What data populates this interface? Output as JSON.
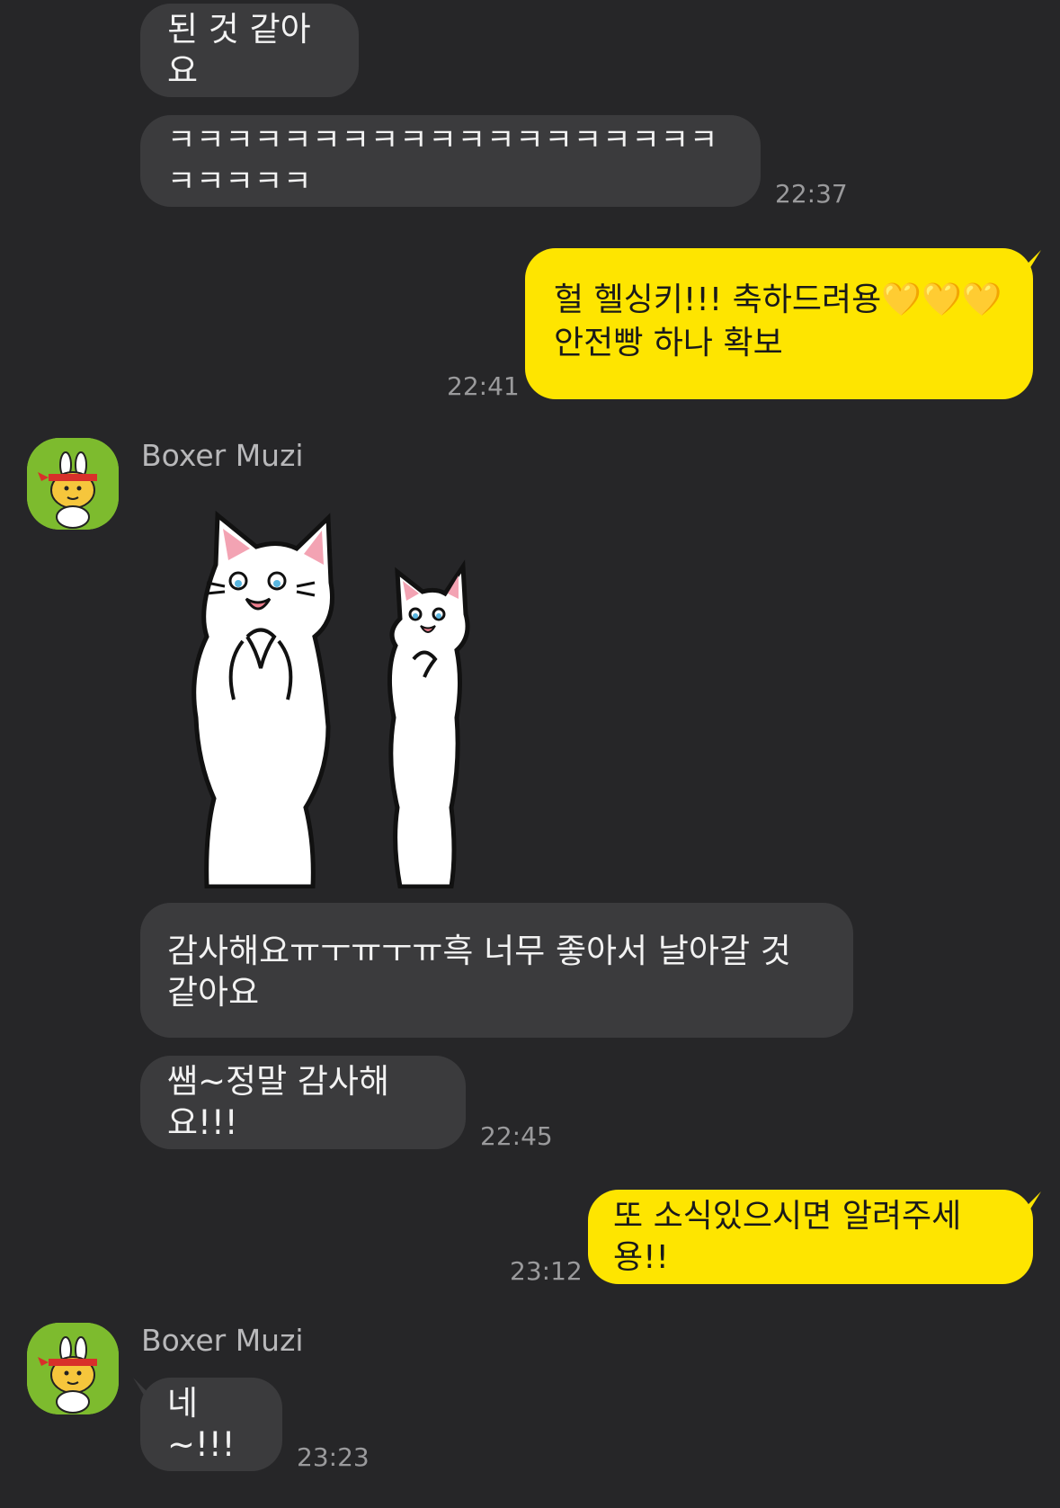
{
  "colors": {
    "background": "#262628",
    "received_bubble": "#3b3b3d",
    "sent_bubble": "#fee500",
    "timestamp": "#9a9a9c"
  },
  "messages": {
    "m1": {
      "text": "된 것 같아요"
    },
    "m2": {
      "text": "ㅋㅋㅋㅋㅋㅋㅋㅋㅋㅋㅋㅋㅋㅋㅋㅋㅋㅋㅋㅋㅋㅋㅋㅋ",
      "time": "22:37"
    },
    "m3": {
      "line1": "헐 헬싱키!!! 축하드려용",
      "hearts": "💛💛💛",
      "line2": "안전빵 하나 확보",
      "time": "22:41"
    },
    "m4": {
      "sender": "Boxer Muzi",
      "sticker": "white-cats-sticker"
    },
    "m5": {
      "text": "감사해요ㅠㅜㅠㅜㅠ흑 너무 좋아서 날아갈 것 같아요"
    },
    "m6": {
      "text": "쌤~정말 감사해요!!!",
      "time": "22:45"
    },
    "m7": {
      "text": "또 소식있으시면 알려주세용!!",
      "time": "23:12"
    },
    "m8": {
      "sender": "Boxer Muzi",
      "text": "네~!!!",
      "time": "23:23"
    }
  }
}
